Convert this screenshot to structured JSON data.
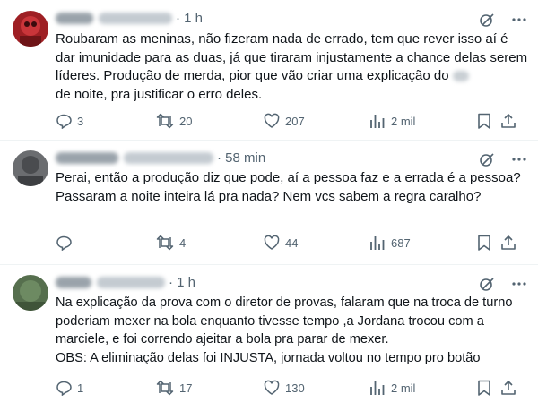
{
  "tweets": [
    {
      "time": "1 h",
      "text_before": "Roubaram as meninas, não fizeram nada de errado, tem que rever isso aí é dar imunidade para as duas, já que tiraram injustamente a chance delas serem líderes. Produção de merda, pior que vão criar uma explicação do",
      "text_after": "de noite, pra justificar o erro deles.",
      "replies": "3",
      "retweets": "20",
      "likes": "207",
      "views": "2 mil",
      "avatar_color": "#b3262b"
    },
    {
      "time": "58 min",
      "text": "Perai, então a produção diz que pode, aí a pessoa faz e a errada é a pessoa? Passaram a noite inteira lá pra nada? Nem vcs sabem a regra caralho?",
      "replies": "",
      "retweets": "4",
      "likes": "44",
      "views": "687",
      "avatar_color": "#5d5f61"
    },
    {
      "time": "1 h",
      "text": "Na explicação da prova com o diretor de provas, falaram que na troca de turno poderiam mexer na bola enquanto tivesse tempo ,a Jordana trocou com a marciele, e foi correndo ajeitar a bola pra parar de mexer.\nOBS: A eliminação delas foi INJUSTA, jornada voltou no tempo pro botão",
      "replies": "1",
      "retweets": "17",
      "likes": "130",
      "views": "2 mil",
      "avatar_color": "#4f6b47"
    }
  ],
  "icons": {
    "grok": "grok-icon",
    "more": "more-icon",
    "reply": "reply-icon",
    "retweet": "retweet-icon",
    "like": "like-icon",
    "views": "views-icon",
    "bookmark": "bookmark-icon",
    "share": "share-icon"
  },
  "colors": {
    "text": "#0f1419",
    "secondary": "#536471",
    "divider": "#eff3f4"
  }
}
